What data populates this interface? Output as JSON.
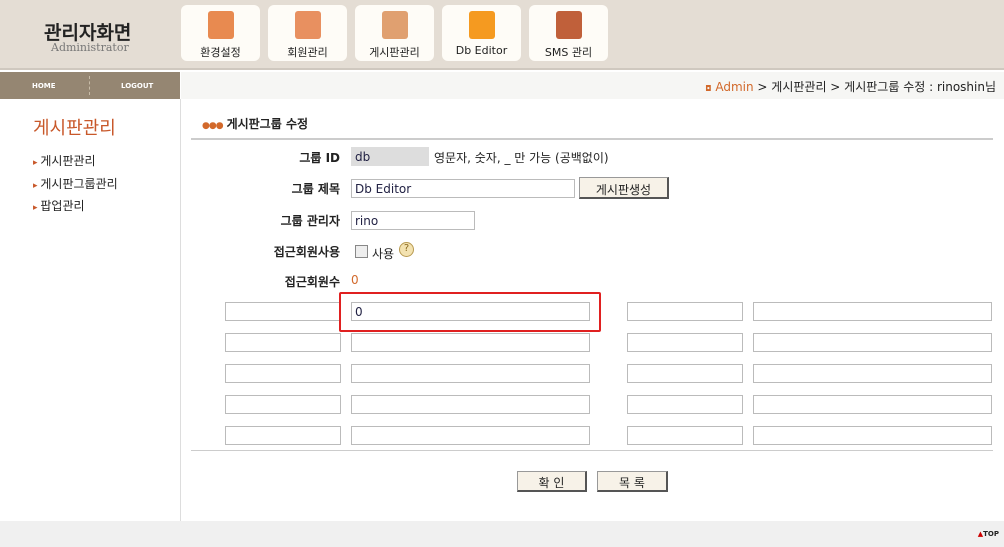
{
  "header": {
    "title": "관리자화면",
    "subtitle": "Administrator",
    "tabs": [
      {
        "label": "환경설정",
        "icon": "monitor-icon",
        "color": "#e88a50"
      },
      {
        "label": "회원관리",
        "icon": "members-icon",
        "color": "#e89060"
      },
      {
        "label": "게시판관리",
        "icon": "notepad-icon",
        "color": "#e0a070"
      },
      {
        "label": "Db Editor",
        "icon": "grid-icon",
        "color": "#f59a20"
      },
      {
        "label": "SMS 관리",
        "icon": "phone-icon",
        "color": "#c0603a"
      }
    ]
  },
  "nav": {
    "home": "HOME",
    "logout": "LOGOUT"
  },
  "breadcrumb": {
    "root": "Admin",
    "path": " > 게시판관리 > 게시판그룹 수정 : rinoshin님"
  },
  "sidebar": {
    "title": "게시판관리",
    "items": [
      "게시판관리",
      "게시판그룹관리",
      "팝업관리"
    ]
  },
  "form": {
    "section_title": "게시판그룹 수정",
    "group_id_label": "그룹 ID",
    "group_id": "db",
    "group_id_hint": "영문자, 숫자, _ 만 가능 (공백없이)",
    "group_title_label": "그룹 제목",
    "group_title": "Db Editor",
    "create_board_btn": "게시판생성",
    "group_admin_label": "그룹 관리자",
    "group_admin": "rino",
    "access_use_label": "접근회원사용",
    "access_use_checkbox": "사용",
    "access_count_label": "접근회원수",
    "access_count": "0",
    "extra_first_value": "0",
    "confirm_btn": "확 인",
    "list_btn": "목 록"
  },
  "footer": {
    "top": "TOP"
  }
}
